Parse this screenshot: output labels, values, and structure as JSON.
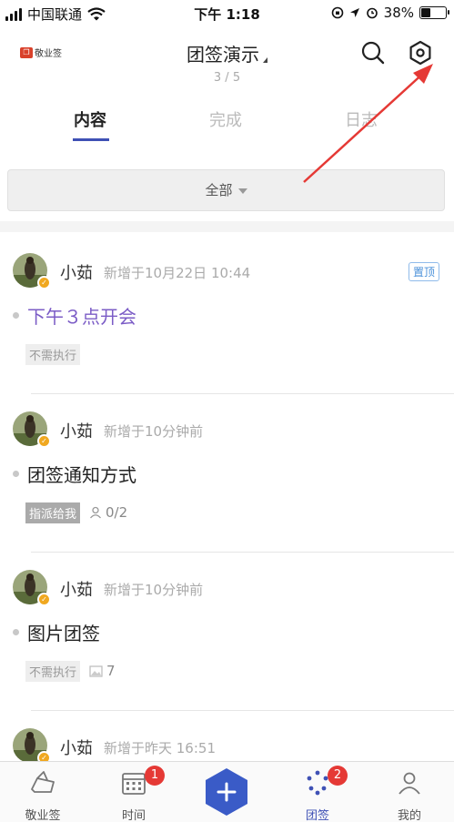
{
  "status_bar": {
    "carrier": "中国联通",
    "time": "下午 1:18",
    "battery": "38%",
    "battery_level": 0.38
  },
  "header": {
    "logo_text": "敬业签",
    "title": "团签演示",
    "page_indicator": "3 / 5"
  },
  "tabs": [
    {
      "label": "内容",
      "active": true
    },
    {
      "label": "完成",
      "active": false
    },
    {
      "label": "日志",
      "active": false
    }
  ],
  "filter": {
    "label": "全部"
  },
  "cards": [
    {
      "author": "小茹",
      "meta": "新增于10月22日 10:44",
      "pin": "置顶",
      "title": "下午３点开会",
      "tag": "不需执行",
      "count": ""
    },
    {
      "author": "小茹",
      "meta": "新增于10分钟前",
      "pin": "",
      "title": "团签通知方式",
      "tag": "指派给我",
      "count": "0/2"
    },
    {
      "author": "小茹",
      "meta": "新增于10分钟前",
      "pin": "",
      "title": "图片团签",
      "tag": "不需执行",
      "count": "7"
    },
    {
      "author": "小茹",
      "meta": "新增于昨天 16:51",
      "pin": "",
      "title": "",
      "tag": "",
      "count": ""
    }
  ],
  "bottom_nav": {
    "items": [
      {
        "label": "敬业签",
        "icon": "home-icon",
        "badge": ""
      },
      {
        "label": "时间",
        "icon": "calendar-icon",
        "badge": "1"
      },
      {
        "label": "团签",
        "icon": "team-icon",
        "badge": "2"
      },
      {
        "label": "我的",
        "icon": "profile-icon",
        "badge": ""
      }
    ],
    "add_icon": "plus-icon"
  },
  "colors": {
    "accent": "#3f51b5",
    "pin": "#4a90d9",
    "title_accent": "#7b5cc6",
    "badge": "#e53935",
    "arrow": "#e53935"
  }
}
